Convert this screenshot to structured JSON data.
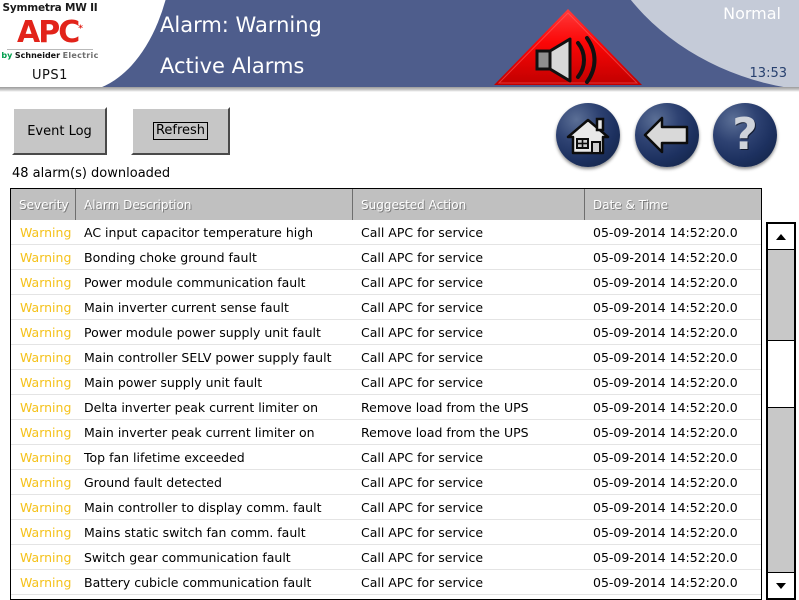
{
  "header": {
    "logo": {
      "model": "Symmetra MW II",
      "brand": "APC",
      "brand_mark": "*",
      "by": "by",
      "schneider": "Schneider",
      "electric": "Electric",
      "unit": "UPS1"
    },
    "title_line1": "Alarm: Warning",
    "title_line2": "Active Alarms",
    "status": "Normal",
    "time": "13:53",
    "alarm_icon": "alarm-horn-icon",
    "colors": {
      "header_blue": "#4e5d8c",
      "panel_grey": "#c5cbd8",
      "apc_red": "#e2231a",
      "alarm_red": "#ff0000",
      "time_blue": "#27406e"
    }
  },
  "toolbar": {
    "event_log_label": "Event Log",
    "refresh_label": "Refresh",
    "alarm_count_text": "48 alarm(s) downloaded",
    "nav": {
      "home": "home-icon",
      "back": "back-arrow-icon",
      "help": "?"
    }
  },
  "table": {
    "columns": [
      "Severity",
      "Alarm Description",
      "Suggested Action",
      "Date & Time"
    ],
    "severity_color": "#f5c21b",
    "rows": [
      {
        "severity": "Warning",
        "description": "AC input capacitor temperature high",
        "action": "Call APC for service",
        "datetime": "05-09-2014 14:52:20.0"
      },
      {
        "severity": "Warning",
        "description": "Bonding choke ground fault",
        "action": "Call APC for service",
        "datetime": "05-09-2014 14:52:20.0"
      },
      {
        "severity": "Warning",
        "description": "Power module communication fault",
        "action": "Call APC for service",
        "datetime": "05-09-2014 14:52:20.0"
      },
      {
        "severity": "Warning",
        "description": "Main inverter current sense fault",
        "action": "Call APC for service",
        "datetime": "05-09-2014 14:52:20.0"
      },
      {
        "severity": "Warning",
        "description": "Power module power supply unit fault",
        "action": "Call APC for service",
        "datetime": "05-09-2014 14:52:20.0"
      },
      {
        "severity": "Warning",
        "description": "Main controller SELV power supply fault",
        "action": "Call APC for service",
        "datetime": "05-09-2014 14:52:20.0"
      },
      {
        "severity": "Warning",
        "description": "Main power supply unit fault",
        "action": "Call APC for service",
        "datetime": "05-09-2014 14:52:20.0"
      },
      {
        "severity": "Warning",
        "description": "Delta inverter peak current limiter on",
        "action": "Remove load from the UPS",
        "datetime": "05-09-2014 14:52:20.0"
      },
      {
        "severity": "Warning",
        "description": "Main inverter peak current limiter on",
        "action": "Remove load from the UPS",
        "datetime": "05-09-2014 14:52:20.0"
      },
      {
        "severity": "Warning",
        "description": "Top fan lifetime exceeded",
        "action": "Call APC for service",
        "datetime": "05-09-2014 14:52:20.0"
      },
      {
        "severity": "Warning",
        "description": "Ground fault detected",
        "action": "Call APC for service",
        "datetime": "05-09-2014 14:52:20.0"
      },
      {
        "severity": "Warning",
        "description": "Main controller to display comm. fault",
        "action": "Call APC for service",
        "datetime": "05-09-2014 14:52:20.0"
      },
      {
        "severity": "Warning",
        "description": "Mains static switch fan comm. fault",
        "action": "Call APC for service",
        "datetime": "05-09-2014 14:52:20.0"
      },
      {
        "severity": "Warning",
        "description": "Switch gear communication fault",
        "action": "Call APC for service",
        "datetime": "05-09-2014 14:52:20.0"
      },
      {
        "severity": "Warning",
        "description": "Battery cubicle communication fault",
        "action": "Call APC for service",
        "datetime": "05-09-2014 14:52:20.0"
      }
    ]
  },
  "scrollbar": {
    "up_arrow": "scroll-up-icon",
    "down_arrow": "scroll-down-icon"
  }
}
